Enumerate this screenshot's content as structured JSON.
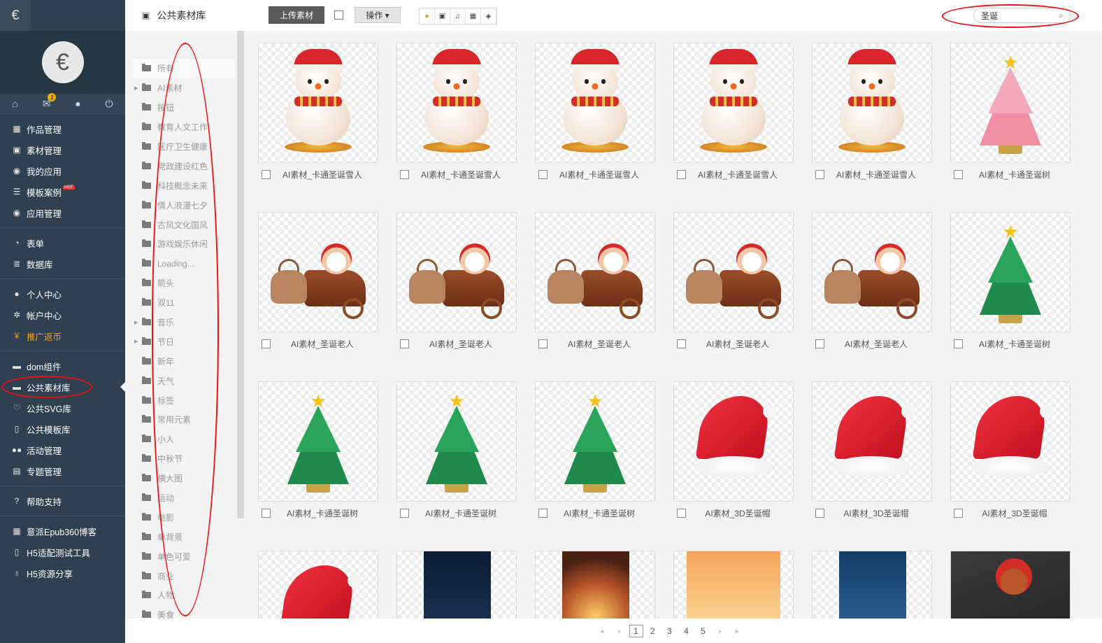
{
  "nav": {
    "logo_glyph": "€",
    "avatar_glyph": "€",
    "mail_badge": "1",
    "groups": [
      [
        {
          "label": "作品管理",
          "icon": "grid-icon"
        },
        {
          "label": "素材管理",
          "icon": "image-icon"
        },
        {
          "label": "我的应用",
          "icon": "app-icon"
        },
        {
          "label": "模板案例",
          "icon": "list-icon",
          "hot": "HOT"
        },
        {
          "label": "应用管理",
          "icon": "app-icon"
        }
      ],
      [
        {
          "label": "表单",
          "icon": "pie-icon"
        },
        {
          "label": "数据库",
          "icon": "database-icon"
        }
      ],
      [
        {
          "label": "个人中心",
          "icon": "user-icon"
        },
        {
          "label": "帐户中心",
          "icon": "gear-icon"
        },
        {
          "label": "推广返币",
          "icon": "yen-icon",
          "promo": true
        }
      ],
      [
        {
          "label": "dom组件",
          "icon": "briefcase-icon"
        },
        {
          "label": "公共素材库",
          "icon": "briefcase-icon",
          "active": true
        },
        {
          "label": "公共SVG库",
          "icon": "heart-icon"
        },
        {
          "label": "公共模板库",
          "icon": "book-icon"
        },
        {
          "label": "活动管理",
          "icon": "users-icon"
        },
        {
          "label": "专题管理",
          "icon": "note-icon"
        }
      ],
      [
        {
          "label": "帮助支持",
          "icon": "question-icon"
        }
      ],
      [
        {
          "label": "意派Epub360博客",
          "icon": "grid-icon"
        },
        {
          "label": "H5适配测试工具",
          "icon": "phone-icon"
        },
        {
          "label": "H5资源分享",
          "icon": "bulb-icon"
        }
      ]
    ]
  },
  "header": {
    "title": "公共素材库",
    "upload_label": "上传素材",
    "ops_label": "操作 ▾",
    "search_value": "圣诞"
  },
  "categories": [
    {
      "label": "所有",
      "selected": true
    },
    {
      "label": "AI素材",
      "expandable": true
    },
    {
      "label": "按钮"
    },
    {
      "label": "教育人文工作"
    },
    {
      "label": "医疗卫生健康"
    },
    {
      "label": "党政建设红色"
    },
    {
      "label": "科技概念未来"
    },
    {
      "label": "情人浪漫七夕"
    },
    {
      "label": "古风文化国风"
    },
    {
      "label": "游戏娱乐休闲"
    },
    {
      "label": "Loading..."
    },
    {
      "label": "箭头"
    },
    {
      "label": "双11"
    },
    {
      "label": "音乐",
      "expandable": true
    },
    {
      "label": "节日",
      "expandable": true
    },
    {
      "label": "新年"
    },
    {
      "label": "天气"
    },
    {
      "label": "标签"
    },
    {
      "label": "常用元素"
    },
    {
      "label": "小人"
    },
    {
      "label": "中秋节"
    },
    {
      "label": "横大图"
    },
    {
      "label": "运动"
    },
    {
      "label": "电影"
    },
    {
      "label": "单背景"
    },
    {
      "label": "单色可爱"
    },
    {
      "label": "商业"
    },
    {
      "label": "人物"
    },
    {
      "label": "美食"
    }
  ],
  "assets": [
    {
      "name": "AI素材_卡通圣诞雪人",
      "kind": "snowman"
    },
    {
      "name": "AI素材_卡通圣诞雪人",
      "kind": "snowman"
    },
    {
      "name": "AI素材_卡通圣诞雪人",
      "kind": "snowman"
    },
    {
      "name": "AI素材_卡通圣诞雪人",
      "kind": "snowman"
    },
    {
      "name": "AI素材_卡通圣诞雪人",
      "kind": "snowman"
    },
    {
      "name": "AI素材_卡通圣诞树",
      "kind": "pinktree"
    },
    {
      "name": "AI素材_圣诞老人",
      "kind": "sleigh"
    },
    {
      "name": "AI素材_圣诞老人",
      "kind": "sleigh"
    },
    {
      "name": "AI素材_圣诞老人",
      "kind": "sleigh"
    },
    {
      "name": "AI素材_圣诞老人",
      "kind": "sleigh"
    },
    {
      "name": "AI素材_圣诞老人",
      "kind": "sleigh"
    },
    {
      "name": "AI素材_卡通圣诞树",
      "kind": "tree"
    },
    {
      "name": "AI素材_卡通圣诞树",
      "kind": "tree"
    },
    {
      "name": "AI素材_卡通圣诞树",
      "kind": "tree"
    },
    {
      "name": "AI素材_卡通圣诞树",
      "kind": "tree"
    },
    {
      "name": "AI素材_3D圣诞帽",
      "kind": "hat"
    },
    {
      "name": "AI素材_3D圣诞帽",
      "kind": "hat"
    },
    {
      "name": "AI素材_3D圣诞帽",
      "kind": "hat"
    },
    {
      "name": "",
      "kind": "hat"
    },
    {
      "name": "",
      "kind": "night"
    },
    {
      "name": "",
      "kind": "warm"
    },
    {
      "name": "",
      "kind": "sunset"
    },
    {
      "name": "",
      "kind": "blue"
    },
    {
      "name": "",
      "kind": "dark"
    }
  ],
  "pager": {
    "first": "«",
    "prev": "‹",
    "pages": [
      "1",
      "2",
      "3",
      "4",
      "5"
    ],
    "current": "1",
    "next": "›",
    "last": "»"
  }
}
